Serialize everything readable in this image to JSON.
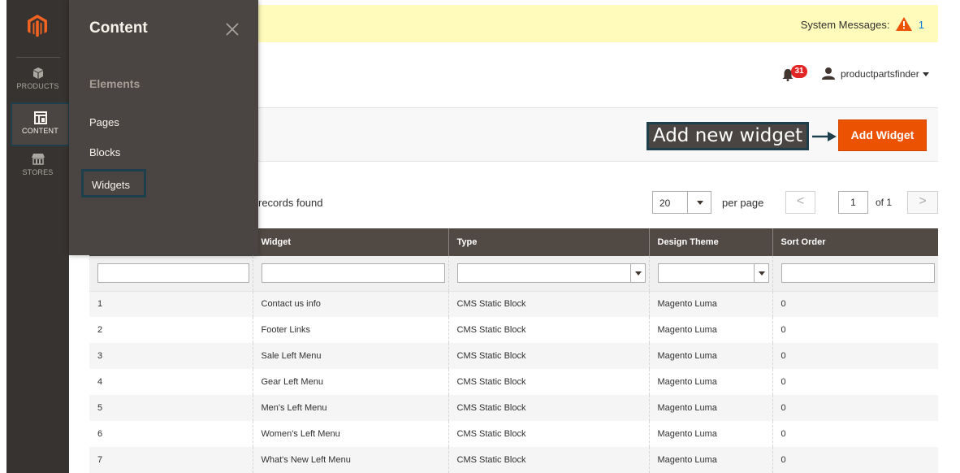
{
  "nav": {
    "items": [
      {
        "label": "PRODUCTS",
        "icon": "cube-icon"
      },
      {
        "label": "CONTENT",
        "icon": "layout-icon"
      },
      {
        "label": "STORES",
        "icon": "store-icon"
      }
    ]
  },
  "flyout": {
    "title": "Content",
    "section": "Elements",
    "links": [
      "Pages",
      "Blocks",
      "Widgets"
    ]
  },
  "system_messages": {
    "label": "System Messages:",
    "count": "1"
  },
  "header": {
    "notifications_count": "31",
    "username": "productpartsfinder"
  },
  "actions": {
    "callout": "Add new widget",
    "add_button": "Add Widget"
  },
  "toolbar": {
    "records_text": "records found",
    "per_page_value": "20",
    "per_page_label": "per page",
    "prev": "<",
    "next": ">",
    "page": "1",
    "page_of": "of 1"
  },
  "grid": {
    "columns": [
      "",
      "Widget",
      "Type",
      "Design Theme",
      "Sort Order"
    ],
    "rows": [
      [
        "1",
        "Contact us info",
        "CMS Static Block",
        "Magento Luma",
        "0"
      ],
      [
        "2",
        "Footer Links",
        "CMS Static Block",
        "Magento Luma",
        "0"
      ],
      [
        "3",
        "Sale Left Menu",
        "CMS Static Block",
        "Magento Luma",
        "0"
      ],
      [
        "4",
        "Gear Left Menu",
        "CMS Static Block",
        "Magento Luma",
        "0"
      ],
      [
        "5",
        "Men's Left Menu",
        "CMS Static Block",
        "Magento Luma",
        "0"
      ],
      [
        "6",
        "Women's Left Menu",
        "CMS Static Block",
        "Magento Luma",
        "0"
      ],
      [
        "7",
        "What's New Left Menu",
        "CMS Static Block",
        "Magento Luma",
        "0"
      ]
    ]
  },
  "colors": {
    "accent": "#eb5202",
    "nav_bg": "#373330",
    "header_row": "#514943",
    "highlight_border": "#1e3f4c"
  }
}
